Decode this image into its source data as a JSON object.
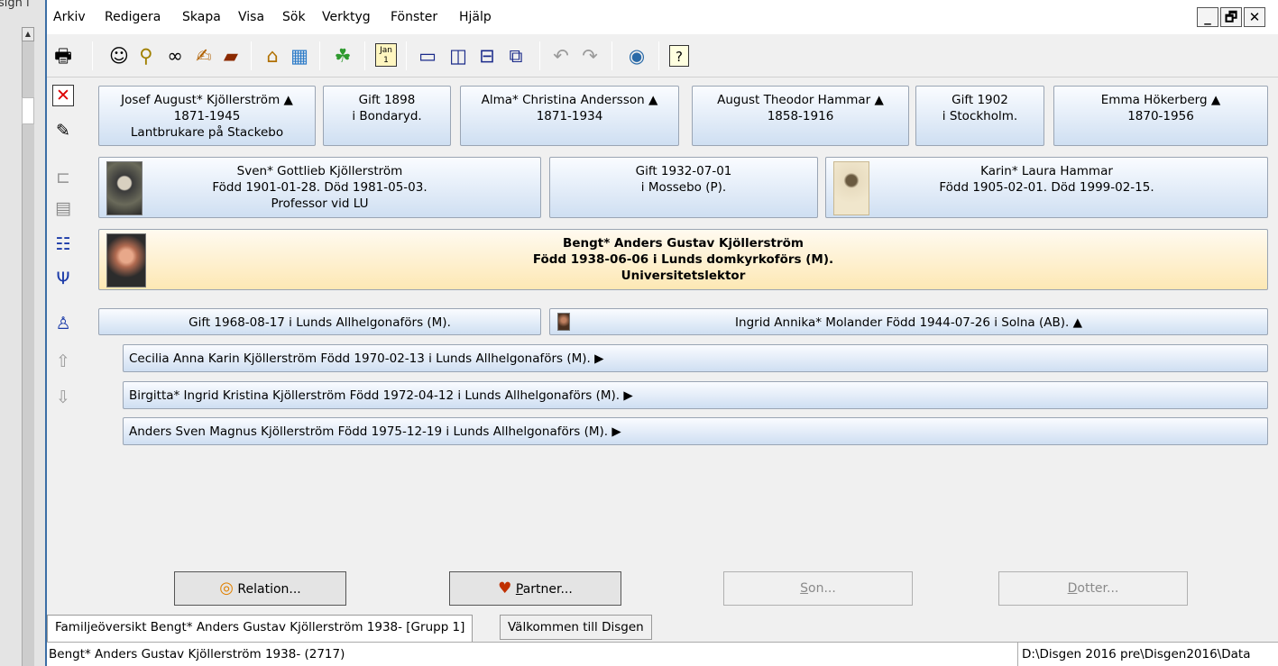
{
  "behind": {
    "fragment": "sign i"
  },
  "menu": {
    "items": [
      "Arkiv",
      "Redigera",
      "Skapa",
      "Visa",
      "Sök",
      "Verktyg",
      "Fönster",
      "Hjälp"
    ]
  },
  "window_controls": {
    "minimize": "_",
    "restore": "🗗",
    "close": "✕"
  },
  "toolbar": {
    "icons": [
      "print-icon",
      "person-icon",
      "person-search-icon",
      "binoculars-icon",
      "edit-hand-icon",
      "book-icon",
      "home-icon",
      "map-book-icon",
      "map-icon",
      "calendar-icon",
      "window-single-icon",
      "window-split-vertical-icon",
      "window-split-horizontal-icon",
      "window-cascade-icon",
      "undo-icon",
      "redo-icon",
      "globe-icon",
      "help-icon"
    ],
    "calendar_text": "Jan 1",
    "help_text": "?"
  },
  "side_icons": [
    "delete-icon",
    "notes-icon",
    "tree-icon",
    "building-icon",
    "columns-icon",
    "descendants-icon",
    "hierarchy-icon",
    "up-house-icon",
    "down-house-icon"
  ],
  "grandparents": [
    {
      "line1": "Josef August* Kjöllerström ▲",
      "line2": "1871-1945",
      "line3": "Lantbrukare på Stackebo"
    },
    {
      "line1": "Gift 1898",
      "line2": "i Bondaryd.",
      "line3": ""
    },
    {
      "line1": "Alma* Christina Andersson ▲",
      "line2": "1871-1934",
      "line3": ""
    },
    {
      "line1": "August Theodor Hammar ▲",
      "line2": "1858-1916",
      "line3": ""
    },
    {
      "line1": "Gift 1902",
      "line2": "i Stockholm.",
      "line3": ""
    },
    {
      "line1": "Emma Hökerberg ▲",
      "line2": "1870-1956",
      "line3": ""
    }
  ],
  "parents": [
    {
      "line1": "Sven* Gottlieb Kjöllerström",
      "line2": "Född 1901-01-28. Död 1981-05-03.",
      "line3": "Professor vid LU"
    },
    {
      "line1": "Gift 1932-07-01",
      "line2": "i Mossebo (P).",
      "line3": ""
    },
    {
      "line1": "Karin* Laura Hammar",
      "line2": "Född 1905-02-01. Död 1999-02-15.",
      "line3": ""
    }
  ],
  "main_person": {
    "line1": "Bengt* Anders Gustav Kjöllerström",
    "line2": "Född 1938-06-06 i Lunds domkyrkoförs (M).",
    "line3": "Universitetslektor"
  },
  "marriage": {
    "text": "Gift 1968-08-17 i Lunds Allhelgonaförs (M)."
  },
  "spouse": {
    "text": "Ingrid Annika* Molander Född 1944-07-26 i Solna (AB). ▲"
  },
  "children": [
    {
      "text": "Cecilia Anna Karin Kjöllerström Född 1970-02-13 i Lunds Allhelgonaförs (M). ▶"
    },
    {
      "text": "Birgitta* Ingrid Kristina Kjöllerström Född 1972-04-12 i Lunds Allhelgonaförs (M). ▶"
    },
    {
      "text": "Anders Sven Magnus Kjöllerström Född 1975-12-19 i Lunds Allhelgonaförs (M). ▶"
    }
  ],
  "buttons": {
    "relation": {
      "label": "Relation..."
    },
    "partner": {
      "mnemonic": "P",
      "rest": "artner..."
    },
    "son": {
      "mnemonic": "S",
      "rest": "on..."
    },
    "dotter": {
      "mnemonic": "D",
      "rest": "otter..."
    }
  },
  "tabs": [
    {
      "label": "Familjeöversikt Bengt* Anders Gustav Kjöllerström 1938- [Grupp 1]"
    },
    {
      "label": "Välkommen till Disgen"
    }
  ],
  "status": {
    "left": "Bengt* Anders Gustav Kjöllerström 1938- (2717)",
    "right": "D:\\Disgen 2016 pre\\Disgen2016\\Data"
  }
}
